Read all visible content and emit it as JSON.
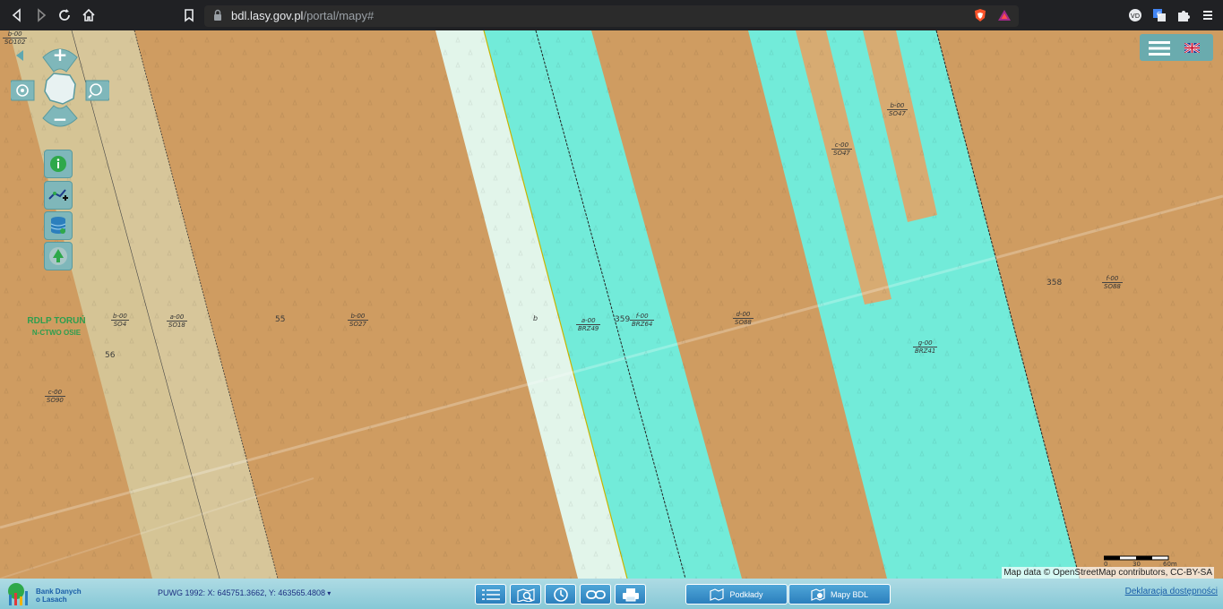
{
  "browser": {
    "url_host": "bdl.lasy.gov.pl",
    "url_path": "/portal/mapy#",
    "nav": {
      "back": "back-icon",
      "forward": "forward-icon",
      "reload": "reload-icon",
      "home": "home-icon"
    },
    "extensions": [
      "brave-shield-icon",
      "brave-rewards-icon",
      "vpn-icon",
      "translate-icon",
      "puzzle-icon",
      "menu-icon"
    ]
  },
  "map": {
    "region_label": {
      "line1": "RDLP TORUŃ",
      "line2": "N-CTWO OSIE"
    },
    "numbers": [
      "55",
      "56",
      "359",
      "358"
    ],
    "small_letter": "b",
    "stand_labels": [
      {
        "top": "b-00",
        "bottom": "SO102"
      },
      {
        "top": "b-00",
        "bottom": "SO4"
      },
      {
        "top": "a-00",
        "bottom": "SO18"
      },
      {
        "top": "b-00",
        "bottom": "SO27"
      },
      {
        "top": "c-00",
        "bottom": "SO90"
      },
      {
        "top": "a-00",
        "bottom": "BRZ49"
      },
      {
        "top": "f-00",
        "bottom": "BRZ64"
      },
      {
        "top": "d-00",
        "bottom": "SO88"
      },
      {
        "top": "c-00",
        "bottom": "SO47"
      },
      {
        "top": "b-00",
        "bottom": "SO47"
      },
      {
        "top": "f-00",
        "bottom": "SO88"
      },
      {
        "top": "g-00",
        "bottom": "BRZ41"
      }
    ],
    "attribution": "Map data © OpenStreetMap contributors, CC-BY-SA",
    "scale": {
      "labels": [
        "0",
        "30",
        "60m"
      ]
    },
    "colors": {
      "pine": "#cf9c61",
      "birch": "#72ebd9",
      "pale": "#e2f5ea",
      "tan": "#d7c69a"
    }
  },
  "controls": {
    "zoom_in": "plus-icon",
    "zoom_out": "minus-icon",
    "tools": [
      "info-icon",
      "measure-icon",
      "database-icon",
      "tree-icon"
    ]
  },
  "bottombar": {
    "logo_text": {
      "line1": "Bank Danych",
      "line2": "o Lasach"
    },
    "coords": "PUWG 1992: X: 645751.3662, Y: 463565.4808",
    "tools": [
      "legend-icon",
      "search-icon",
      "history-icon",
      "link-icon",
      "print-icon"
    ],
    "podklady": "Podkłady",
    "mapy_bdl": "Mapy BDL",
    "accessibility": "Deklaracja dostępności"
  }
}
